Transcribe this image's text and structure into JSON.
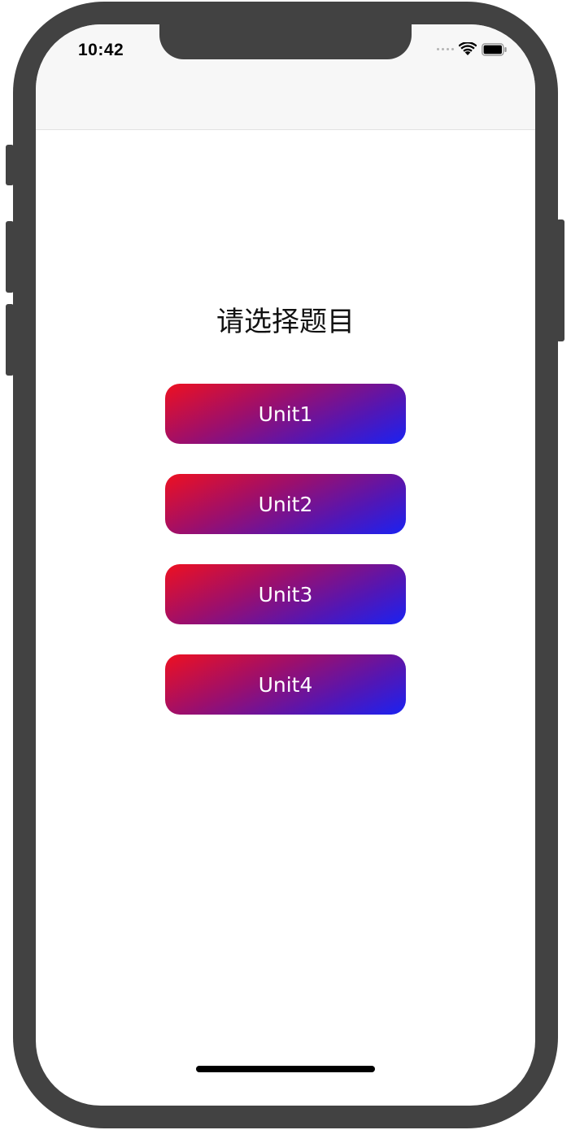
{
  "status_bar": {
    "time": "10:42"
  },
  "main": {
    "title": "请选择题目",
    "buttons": [
      {
        "label": "Unit1"
      },
      {
        "label": "Unit2"
      },
      {
        "label": "Unit3"
      },
      {
        "label": "Unit4"
      }
    ]
  },
  "colors": {
    "gradient_start": "#ee1020",
    "gradient_end": "#1a22f2",
    "frame": "#424242",
    "nav_background": "#f7f7f7"
  },
  "icons": {
    "signal": "cellular-signal-icon",
    "wifi": "wifi-icon",
    "battery": "battery-icon"
  }
}
